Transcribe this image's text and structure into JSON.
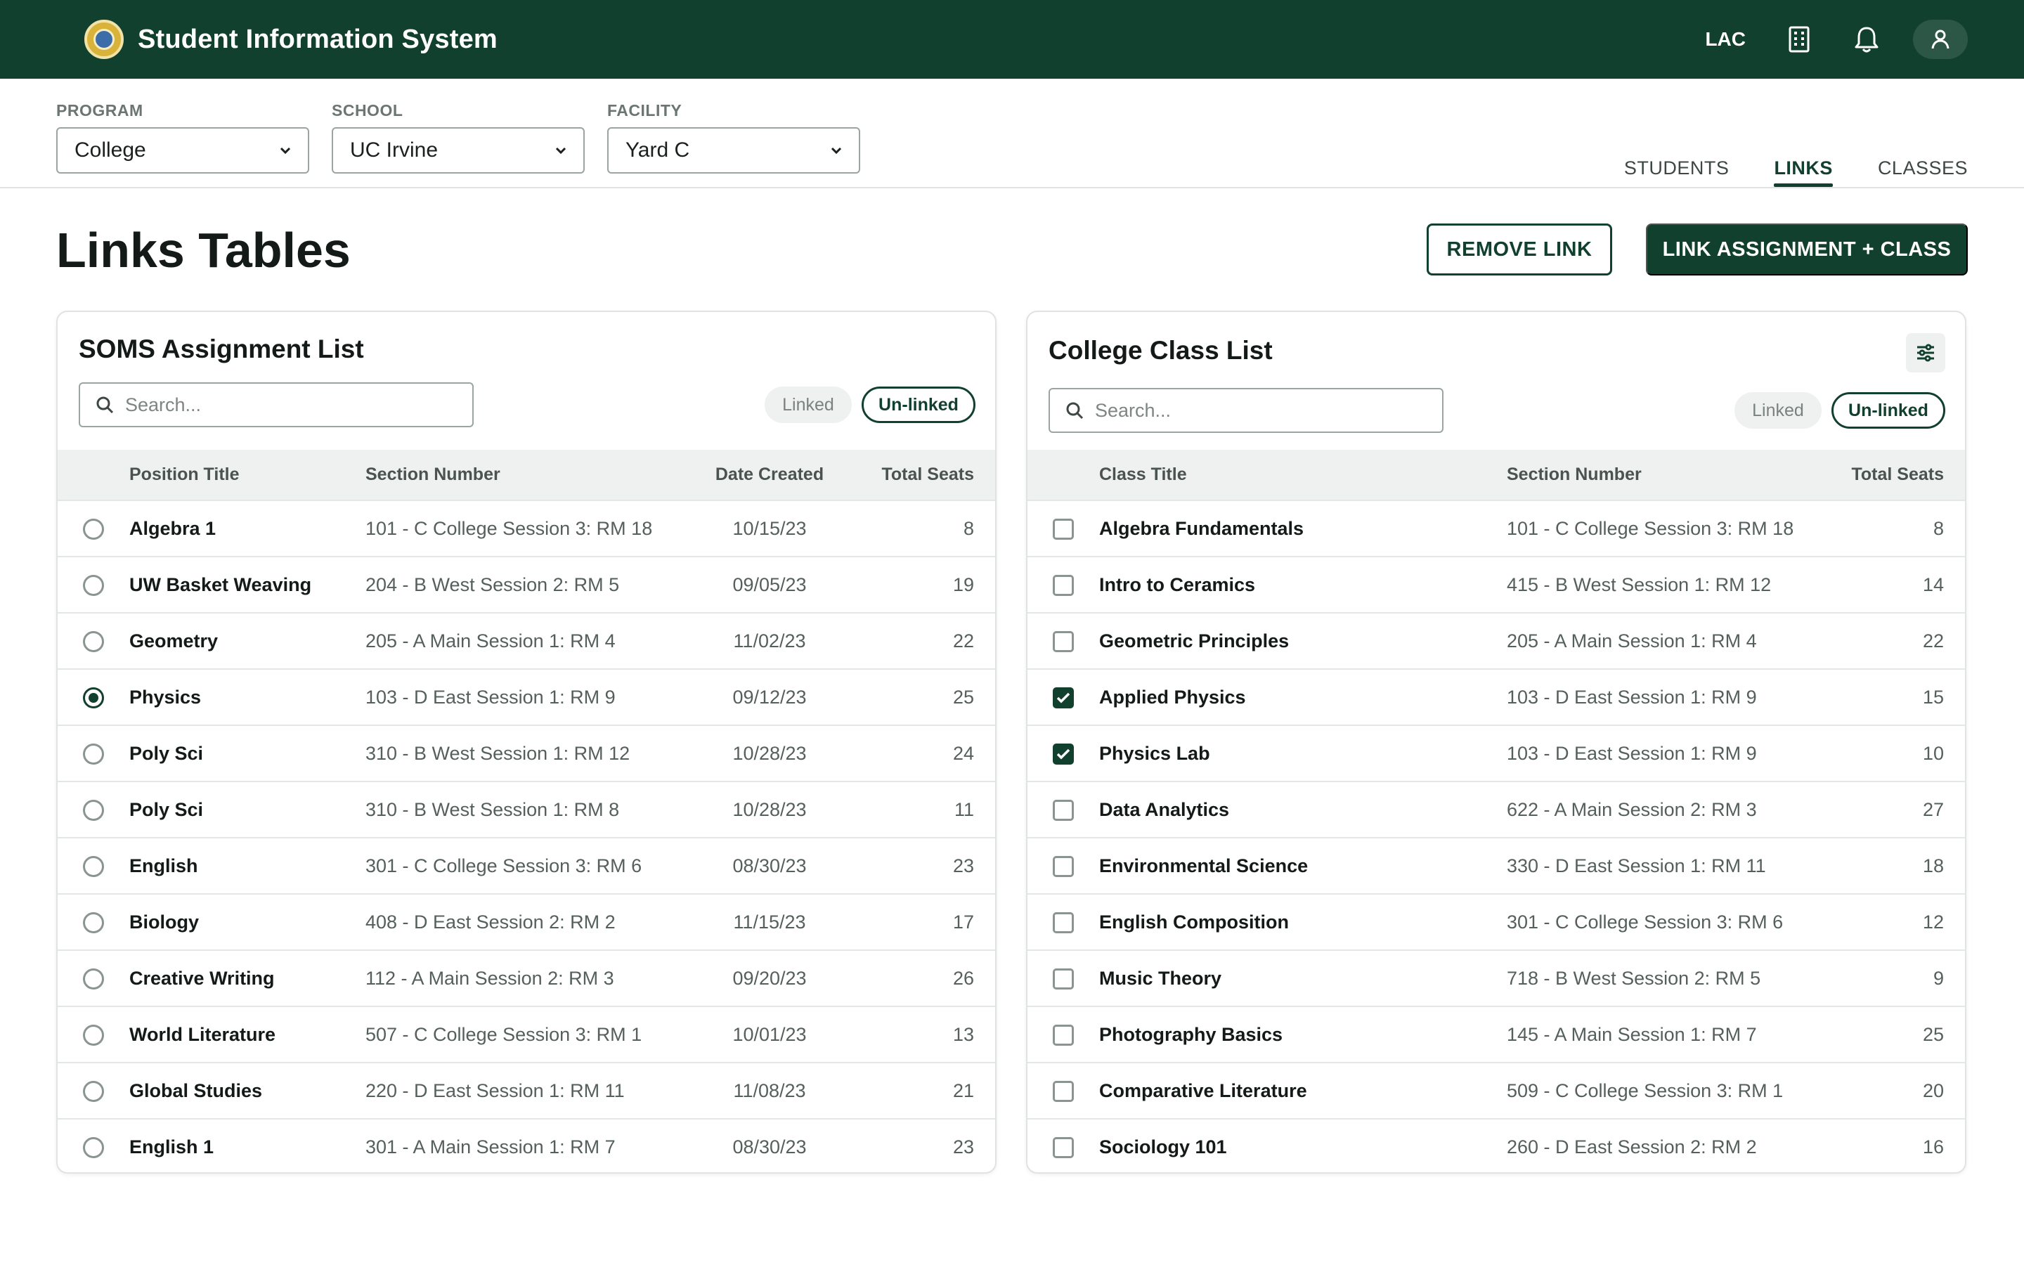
{
  "app": {
    "title": "Student Information System",
    "user_code": "LAC"
  },
  "filters": [
    {
      "label": "PROGRAM",
      "value": "College"
    },
    {
      "label": "SCHOOL",
      "value": "UC Irvine"
    },
    {
      "label": "FACILITY",
      "value": "Yard C"
    }
  ],
  "tabs": [
    {
      "label": "STUDENTS",
      "active": false
    },
    {
      "label": "LINKS",
      "active": true
    },
    {
      "label": "CLASSES",
      "active": false
    }
  ],
  "page": {
    "title": "Links Tables"
  },
  "actions": {
    "remove_label": "REMOVE LINK",
    "link_label": "LINK ASSIGNMENT + CLASS"
  },
  "colors": {
    "brand": "#12402f",
    "row_border": "#e3e7e5",
    "header_bg": "#eef1ef"
  },
  "left_panel": {
    "title": "SOMS Assignment List",
    "search_placeholder": "Search...",
    "linked_label": "Linked",
    "unlinked_label": "Un-linked",
    "columns": [
      "Position Title",
      "Section Number",
      "Date Created",
      "Total Seats"
    ],
    "rows": [
      {
        "title": "Algebra 1",
        "section": "101 - C College Session 3: RM 18",
        "date": "10/15/23",
        "seats": "8",
        "selected": false
      },
      {
        "title": "UW Basket Weaving",
        "section": "204 - B West Session 2: RM 5",
        "date": "09/05/23",
        "seats": "19",
        "selected": false
      },
      {
        "title": "Geometry",
        "section": "205 - A Main Session 1: RM 4",
        "date": "11/02/23",
        "seats": "22",
        "selected": false
      },
      {
        "title": "Physics",
        "section": "103 - D East Session 1: RM 9",
        "date": "09/12/23",
        "seats": "25",
        "selected": true
      },
      {
        "title": "Poly Sci",
        "section": "310 - B West Session 1: RM 12",
        "date": "10/28/23",
        "seats": "24",
        "selected": false
      },
      {
        "title": "Poly Sci",
        "section": "310 - B West Session 1: RM 8",
        "date": "10/28/23",
        "seats": "11",
        "selected": false
      },
      {
        "title": "English",
        "section": "301 - C College Session 3: RM 6",
        "date": "08/30/23",
        "seats": "23",
        "selected": false
      },
      {
        "title": "Biology",
        "section": "408 - D East Session 2: RM 2",
        "date": "11/15/23",
        "seats": "17",
        "selected": false
      },
      {
        "title": "Creative Writing",
        "section": "112 - A Main Session 2: RM 3",
        "date": "09/20/23",
        "seats": "26",
        "selected": false
      },
      {
        "title": "World Literature",
        "section": "507 - C College Session 3: RM 1",
        "date": "10/01/23",
        "seats": "13",
        "selected": false
      },
      {
        "title": "Global Studies",
        "section": "220 - D East Session 1: RM 11",
        "date": "11/08/23",
        "seats": "21",
        "selected": false
      },
      {
        "title": "English 1",
        "section": "301 - A Main Session 1: RM 7",
        "date": "08/30/23",
        "seats": "23",
        "selected": false
      }
    ]
  },
  "right_panel": {
    "title": "College Class List",
    "search_placeholder": "Search...",
    "linked_label": "Linked",
    "unlinked_label": "Un-linked",
    "columns": [
      "Class Title",
      "Section Number",
      "Total Seats"
    ],
    "rows": [
      {
        "title": "Algebra Fundamentals",
        "section": "101 - C College Session 3: RM 18",
        "seats": "8",
        "checked": false
      },
      {
        "title": "Intro to Ceramics",
        "section": "415 - B West Session 1: RM 12",
        "seats": "14",
        "checked": false
      },
      {
        "title": "Geometric Principles",
        "section": "205 - A Main Session 1: RM 4",
        "seats": "22",
        "checked": false
      },
      {
        "title": "Applied Physics",
        "section": "103 - D East Session 1: RM 9",
        "seats": "15",
        "checked": true
      },
      {
        "title": "Physics Lab",
        "section": "103 - D East Session 1: RM 9",
        "seats": "10",
        "checked": true
      },
      {
        "title": "Data Analytics",
        "section": "622 - A Main Session 2: RM 3",
        "seats": "27",
        "checked": false
      },
      {
        "title": "Environmental Science",
        "section": "330 - D East Session 1: RM 11",
        "seats": "18",
        "checked": false
      },
      {
        "title": "English Composition",
        "section": "301 - C College Session 3: RM 6",
        "seats": "12",
        "checked": false
      },
      {
        "title": "Music Theory",
        "section": "718 - B West Session 2: RM 5",
        "seats": "9",
        "checked": false
      },
      {
        "title": "Photography Basics",
        "section": "145 - A Main Session 1: RM 7",
        "seats": "25",
        "checked": false
      },
      {
        "title": "Comparative Literature",
        "section": "509 - C College Session 3: RM 1",
        "seats": "20",
        "checked": false
      },
      {
        "title": "Sociology 101",
        "section": "260 - D East Session 2: RM 2",
        "seats": "16",
        "checked": false
      }
    ]
  }
}
